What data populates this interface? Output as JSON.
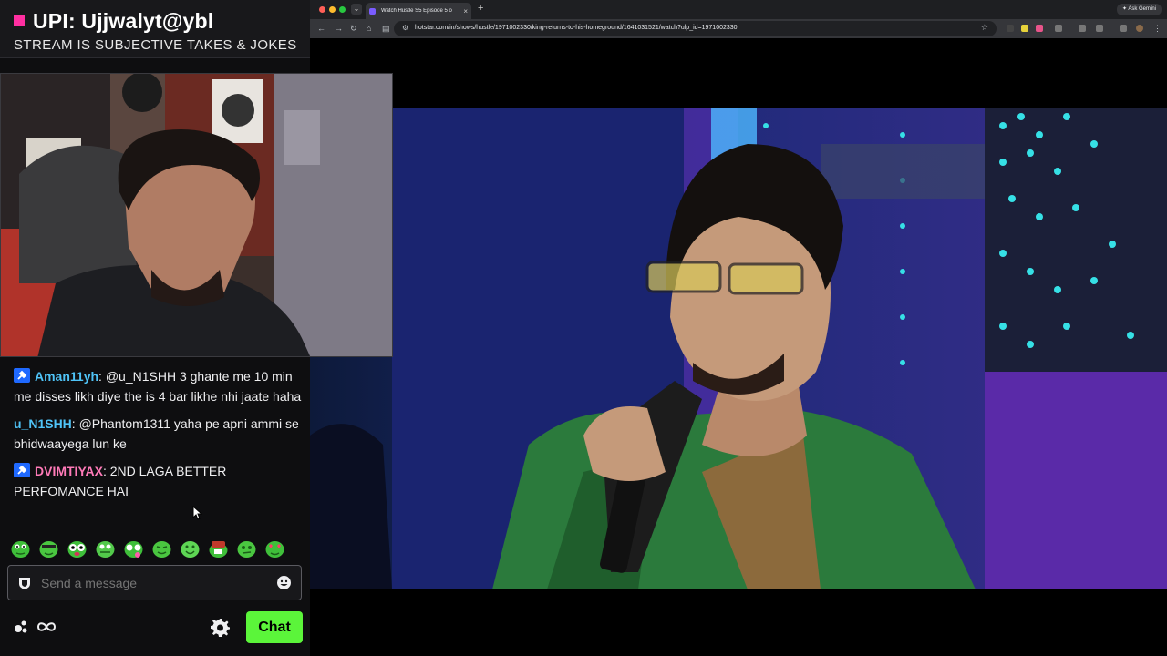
{
  "stream": {
    "upi": "UPI: Ujjwalyt@ybl",
    "subtitle": "STREAM IS SUBJECTIVE TAKES & JOKES"
  },
  "chat": {
    "messages": [
      {
        "user": "Aman11yh",
        "color": "#4fc3f7",
        "badge": true,
        "text": "@u_N1SHH 3 ghante me 10 min me disses likh diye the is 4 bar likhe nhi jaate haha"
      },
      {
        "user": "u_N1SHH",
        "color": "#4fc3f7",
        "badge": false,
        "text": "@Phantom1311 yaha pe apni ammi se bhidwaayega lun ke"
      },
      {
        "user": "DVIMTIYAX",
        "color": "#ff7ab8",
        "badge": true,
        "text": "2ND LAGA BETTER PERFOMANCE HAI"
      }
    ],
    "input_placeholder": "Send a message",
    "send_label": "Chat",
    "emote_icons": [
      "pepe-emote",
      "pepe-emote",
      "pepe-emote",
      "pepe-emote",
      "pepe-emote",
      "pepe-emote",
      "pepe-emote",
      "pepe-emote",
      "pepe-emote",
      "pepe-emote"
    ]
  },
  "browser": {
    "tab_title": "Watch Hustle S5 Episode 5 o",
    "url": "hotstar.com/in/shows/hustle/1971002330/king-returns-to-his-homeground/1641031521/watch?ulp_id=1971002330",
    "gemini_label": "Ask Gemini"
  },
  "colors": {
    "accent_green": "#5bf53a",
    "accent_pink": "#ff2fa1",
    "twitch_bg": "#0e0e10"
  }
}
